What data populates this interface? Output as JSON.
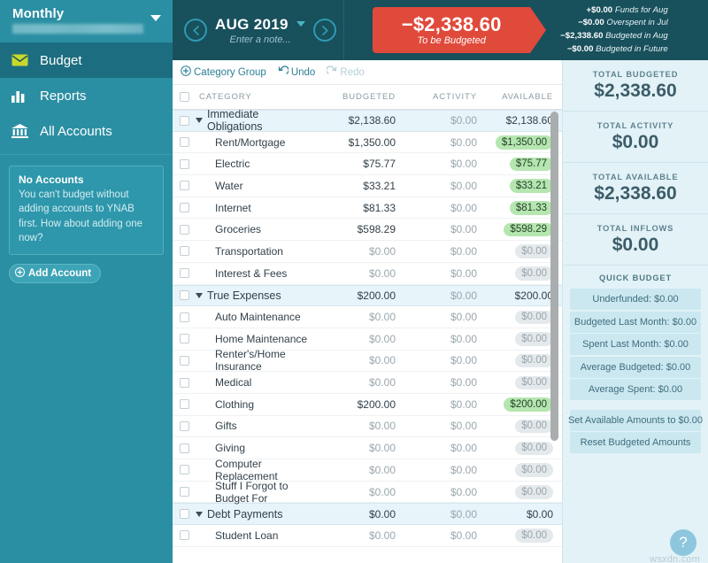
{
  "sidebar": {
    "budget_name": "Monthly",
    "nav": [
      {
        "label": "Budget",
        "icon": "envelope-icon",
        "active": true
      },
      {
        "label": "Reports",
        "icon": "bar-chart-icon",
        "active": false
      },
      {
        "label": "All Accounts",
        "icon": "bank-icon",
        "active": false
      }
    ],
    "accounts_card": {
      "title": "No Accounts",
      "body": "You can't budget without adding accounts to YNAB first. How about adding one now?"
    },
    "add_account_label": "Add Account"
  },
  "header": {
    "prev_icon": "chevron-left-icon",
    "next_icon": "chevron-right-icon",
    "month": "AUG 2019",
    "note_placeholder": "Enter a note...",
    "to_be_budgeted": {
      "amount": "−$2,338.60",
      "label": "To be Budgeted",
      "color": "#e04a3b"
    },
    "breakdown": [
      {
        "amount": "+$0.00",
        "label": "Funds for Aug"
      },
      {
        "amount": "−$0.00",
        "label": "Overspent in Jul"
      },
      {
        "amount": "−$2,338.60",
        "label": "Budgeted in Aug"
      },
      {
        "amount": "−$0.00",
        "label": "Budgeted in Future"
      }
    ]
  },
  "toolbar": {
    "category_group_label": "Category Group",
    "category_group_icon": "plus-circle-icon",
    "undo_label": "Undo",
    "undo_icon": "undo-arrow-icon",
    "redo_label": "Redo",
    "redo_icon": "redo-arrow-icon"
  },
  "table": {
    "columns": {
      "category": "CATEGORY",
      "budgeted": "BUDGETED",
      "activity": "ACTIVITY",
      "available": "AVAILABLE"
    },
    "rows": [
      {
        "type": "group",
        "name": "Immediate Obligations",
        "budgeted": "$2,138.60",
        "activity": "$0.00",
        "available": "$2,138.60"
      },
      {
        "type": "child",
        "name": "Rent/Mortgage",
        "budgeted": "$1,350.00",
        "activity": "$0.00",
        "available": "$1,350.00",
        "pill": "green"
      },
      {
        "type": "child",
        "name": "Electric",
        "budgeted": "$75.77",
        "activity": "$0.00",
        "available": "$75.77",
        "pill": "green"
      },
      {
        "type": "child",
        "name": "Water",
        "budgeted": "$33.21",
        "activity": "$0.00",
        "available": "$33.21",
        "pill": "green"
      },
      {
        "type": "child",
        "name": "Internet",
        "budgeted": "$81.33",
        "activity": "$0.00",
        "available": "$81.33",
        "pill": "green"
      },
      {
        "type": "child",
        "name": "Groceries",
        "budgeted": "$598.29",
        "activity": "$0.00",
        "available": "$598.29",
        "pill": "green"
      },
      {
        "type": "child",
        "name": "Transportation",
        "budgeted": "$0.00",
        "activity": "$0.00",
        "available": "$0.00",
        "pill": "grey",
        "zero": true
      },
      {
        "type": "child",
        "name": "Interest & Fees",
        "budgeted": "$0.00",
        "activity": "$0.00",
        "available": "$0.00",
        "pill": "grey",
        "zero": true
      },
      {
        "type": "group",
        "name": "True Expenses",
        "budgeted": "$200.00",
        "activity": "$0.00",
        "available": "$200.00"
      },
      {
        "type": "child",
        "name": "Auto Maintenance",
        "budgeted": "$0.00",
        "activity": "$0.00",
        "available": "$0.00",
        "pill": "grey",
        "zero": true
      },
      {
        "type": "child",
        "name": "Home Maintenance",
        "budgeted": "$0.00",
        "activity": "$0.00",
        "available": "$0.00",
        "pill": "grey",
        "zero": true
      },
      {
        "type": "child",
        "name": "Renter's/Home Insurance",
        "budgeted": "$0.00",
        "activity": "$0.00",
        "available": "$0.00",
        "pill": "grey",
        "zero": true
      },
      {
        "type": "child",
        "name": "Medical",
        "budgeted": "$0.00",
        "activity": "$0.00",
        "available": "$0.00",
        "pill": "grey",
        "zero": true
      },
      {
        "type": "child",
        "name": "Clothing",
        "budgeted": "$200.00",
        "activity": "$0.00",
        "available": "$200.00",
        "pill": "green"
      },
      {
        "type": "child",
        "name": "Gifts",
        "budgeted": "$0.00",
        "activity": "$0.00",
        "available": "$0.00",
        "pill": "grey",
        "zero": true
      },
      {
        "type": "child",
        "name": "Giving",
        "budgeted": "$0.00",
        "activity": "$0.00",
        "available": "$0.00",
        "pill": "grey",
        "zero": true
      },
      {
        "type": "child",
        "name": "Computer Replacement",
        "budgeted": "$0.00",
        "activity": "$0.00",
        "available": "$0.00",
        "pill": "grey",
        "zero": true
      },
      {
        "type": "child",
        "name": "Stuff I Forgot to Budget For",
        "budgeted": "$0.00",
        "activity": "$0.00",
        "available": "$0.00",
        "pill": "grey",
        "zero": true
      },
      {
        "type": "group",
        "name": "Debt Payments",
        "budgeted": "$0.00",
        "activity": "$0.00",
        "available": "$0.00"
      },
      {
        "type": "child",
        "name": "Student Loan",
        "budgeted": "$0.00",
        "activity": "$0.00",
        "available": "$0.00",
        "pill": "grey",
        "zero": true
      }
    ]
  },
  "right_panel": {
    "totals": [
      {
        "label": "TOTAL BUDGETED",
        "value": "$2,338.60"
      },
      {
        "label": "TOTAL ACTIVITY",
        "value": "$0.00"
      },
      {
        "label": "TOTAL AVAILABLE",
        "value": "$2,338.60"
      },
      {
        "label": "TOTAL INFLOWS",
        "value": "$0.00"
      }
    ],
    "quick_budget_title": "QUICK BUDGET",
    "quick_budget_items": [
      "Underfunded: $0.00",
      "Budgeted Last Month: $0.00",
      "Spent Last Month: $0.00",
      "Average Budgeted: $0.00",
      "Average Spent: $0.00"
    ],
    "quick_budget_actions": [
      "Set Available Amounts to $0.00",
      "Reset Budgeted Amounts"
    ],
    "help_icon": "question-mark-icon",
    "help_label": "?",
    "watermark": "wsxdn.com"
  }
}
